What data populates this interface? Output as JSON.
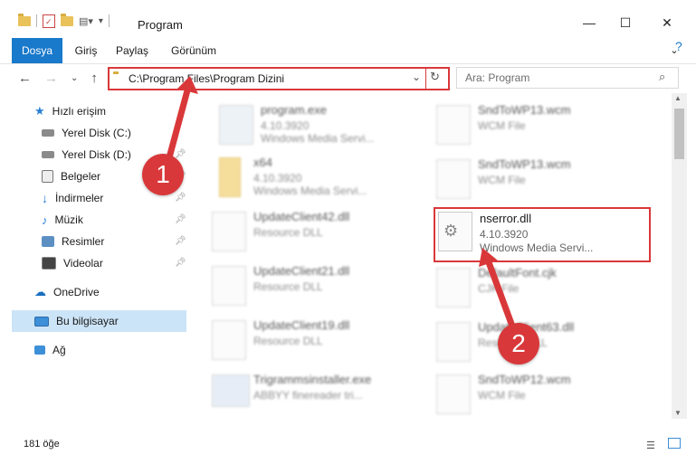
{
  "window": {
    "title": "Program",
    "minimize": "—",
    "maximize": "☐",
    "close": "✕"
  },
  "ribbon": {
    "tabs": [
      "Dosya",
      "Giriş",
      "Paylaş",
      "Görünüm"
    ]
  },
  "address": {
    "path": "C:\\Program Files\\Program Dizini",
    "search_placeholder": "Ara: Program"
  },
  "sidebar": {
    "items": [
      {
        "label": "Hızlı erişim",
        "icon": "star-icon"
      },
      {
        "label": "Yerel Disk (C:)",
        "icon": "drive-icon"
      },
      {
        "label": "Yerel Disk (D:)",
        "icon": "drive-icon"
      },
      {
        "label": "Belgeler",
        "icon": "documents-icon"
      },
      {
        "label": "İndirmeler",
        "icon": "download-icon"
      },
      {
        "label": "Müzik",
        "icon": "music-icon"
      },
      {
        "label": "Resimler",
        "icon": "pictures-icon"
      },
      {
        "label": "Videolar",
        "icon": "video-icon"
      },
      {
        "label": "OneDrive",
        "icon": "cloud-icon"
      },
      {
        "label": "Bu bilgisayar",
        "icon": "computer-icon"
      },
      {
        "label": "Ağ",
        "icon": "network-icon"
      }
    ]
  },
  "files": [
    {
      "name": "program.exe",
      "version": "4.10.3920",
      "desc": "Windows Media Servi..."
    },
    {
      "name": "SndToWP13.wcm",
      "version": "",
      "desc": "WCM File"
    },
    {
      "name": "x64",
      "version": "4.10.3920",
      "desc": "Windows Media Servi..."
    },
    {
      "name": "SndToWP13.wcm",
      "version": "",
      "desc": "WCM File"
    },
    {
      "name": "UpdateClient42.dll",
      "version": "",
      "desc": "Resource DLL"
    },
    {
      "name": "nserror.dll",
      "version": "4.10.3920",
      "desc": "Windows Media Servi..."
    },
    {
      "name": "UpdateClient21.dll",
      "version": "",
      "desc": "Resource DLL"
    },
    {
      "name": "DefaultFont.cjk",
      "version": "",
      "desc": "CJK File"
    },
    {
      "name": "UpdateClient19.dll",
      "version": "",
      "desc": "Resource DLL"
    },
    {
      "name": "UpdateClient63.dll",
      "version": "",
      "desc": "Resource DLL"
    },
    {
      "name": "Trigrammsinstaller.exe",
      "version": "",
      "desc": "ABBYY finereader tri..."
    },
    {
      "name": "SndToWP12.wcm",
      "version": "",
      "desc": "WCM File"
    }
  ],
  "status": {
    "count": "181 öğe"
  },
  "annotations": {
    "step1": "1",
    "step2": "2"
  },
  "colors": {
    "accent": "#1979ca",
    "highlight": "#d9383a",
    "selection": "#cce4f7"
  }
}
